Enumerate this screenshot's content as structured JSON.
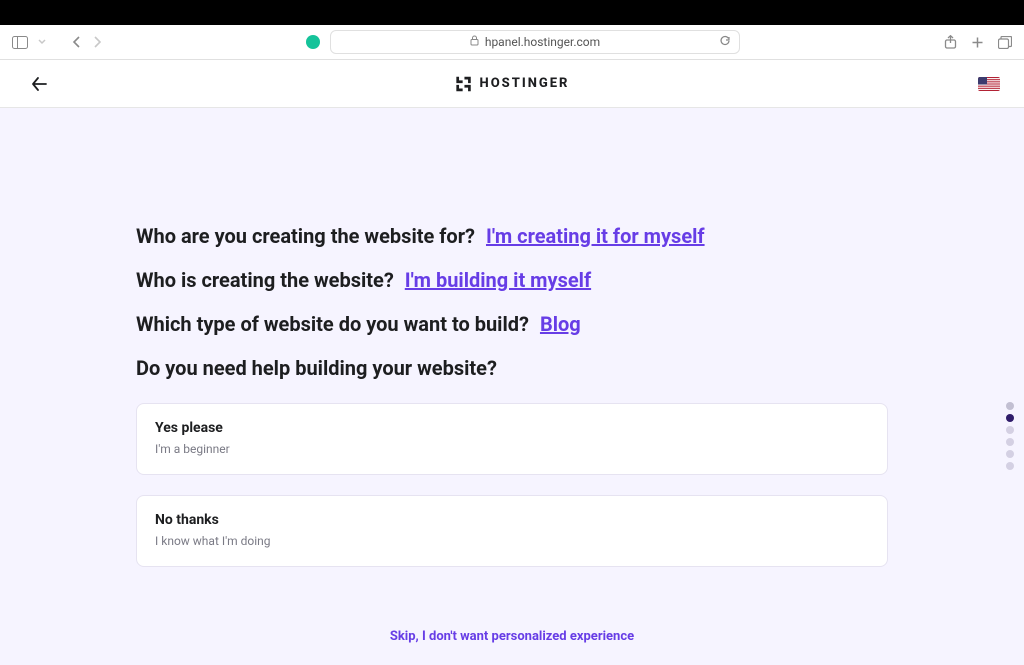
{
  "browser": {
    "url": "hpanel.hostinger.com"
  },
  "header": {
    "brand": "HOSTINGER",
    "locale_flag": "us"
  },
  "questions": [
    {
      "q": "Who are you creating the website for?",
      "a": "I'm creating it for myself"
    },
    {
      "q": "Who is creating the website?",
      "a": "I'm building it myself"
    },
    {
      "q": "Which type of website do you want to build?",
      "a": "Blog"
    },
    {
      "q": "Do you need help building your website?",
      "a": null
    }
  ],
  "options": [
    {
      "title": "Yes please",
      "subtitle": "I'm a beginner"
    },
    {
      "title": "No thanks",
      "subtitle": "I know what I'm doing"
    }
  ],
  "skip_label": "Skip, I don't want personalized experience",
  "progress": {
    "total": 6,
    "current_index": 1
  }
}
